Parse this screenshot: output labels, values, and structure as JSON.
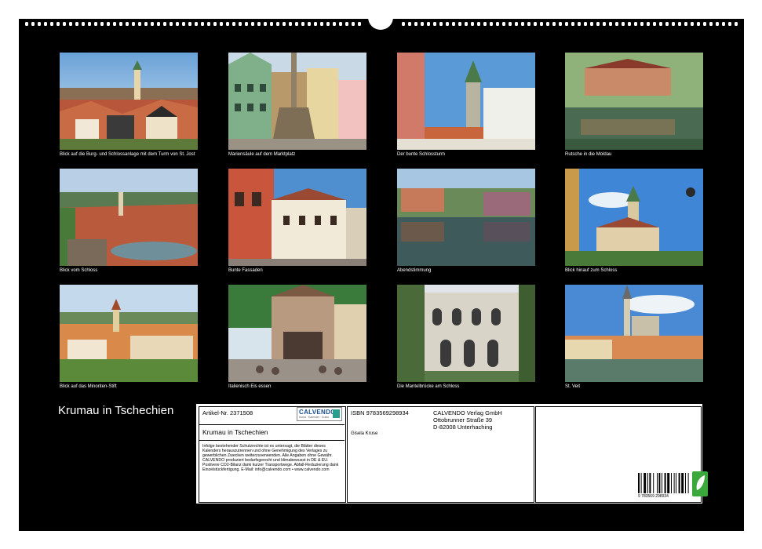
{
  "calendar_title": "Krumau in Tschechien",
  "captions": [
    "Blick auf die Burg- und Schlossanlage mit dem Turm von St. Jost",
    "Mariensäule auf dem Marktplatz",
    "Der bunte Schlossturm",
    "Rutsche in die Moldau",
    "Blick vom Schloss",
    "Bunte Fassaden",
    "Abendstimmung",
    "Blick hinauf zum Schloss",
    "Blick auf das Minoriten-Stift",
    "Italienisch Eis essen",
    "Die Mantelbrücke am Schloss",
    "St. Veit"
  ],
  "info": {
    "article": "Artikel-Nr. 2371508",
    "logo_name": "CALVENDO",
    "logo_sub": "Kunst · Kalender · Kultur",
    "title": "Krumau in Tschechien",
    "legal": "Infolge bestehender Schutzrechte ist es untersagt, die Blätter dieses Kalenders herauszutrennen und ohne Genehmigung des Verlages zu gewerblichen Zwecken weiterzuverwenden. Alle Angaben ohne Gewähr. CALVENDO produziert bedarfsgerecht und klimabewusst in DE & EU. Postivere CO2-Bilanz dank kurzer Transportwege. Abfall-Reduzierung dank Einzelstückfertigung. E-Mail: info@calvendo.com • www.calvendo.com",
    "isbn": "ISBN 9783569298934",
    "author": "Gisela Kruse",
    "publisher_1": "CALVENDO Verlag GmbH",
    "publisher_2": "Ottobrunner Straße 39",
    "publisher_3": "D-82008 Unterhaching",
    "barcode_number": "9 783569 298934"
  },
  "colors": {
    "sheet": "#000000",
    "logo_blue": "#1a4f8c",
    "eco_green": "#3aa83a"
  }
}
